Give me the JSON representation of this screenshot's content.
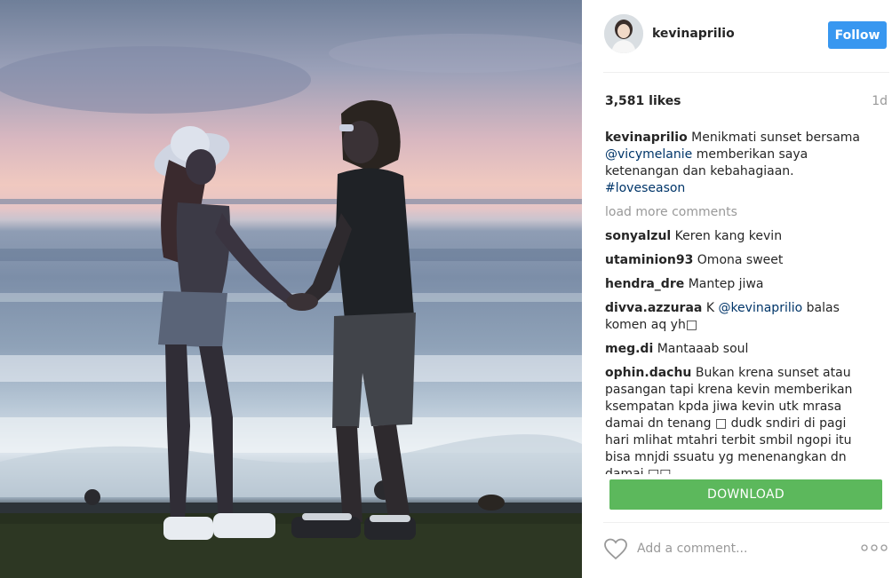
{
  "post": {
    "image_alt": "Couple holding hands at sunset by the sea",
    "author": {
      "username": "kevinaprilio",
      "avatar_icon": "profile-avatar"
    },
    "follow_label": "Follow",
    "likes": "3,581 likes",
    "age": "1d",
    "caption": {
      "user": "kevinaprilio",
      "text1": "Menikmati sunset bersama ",
      "mention": "@vicymelanie",
      "text2": " memberikan saya ketenangan dan kebahagiaan. ",
      "hashtag": "#loveseason"
    },
    "load_more": "load more comments",
    "comments": [
      {
        "user": "sonyalzul",
        "text": "Keren kang kevin"
      },
      {
        "user": "utaminion93",
        "text": "Omona sweet"
      },
      {
        "user": "hendra_dre",
        "text": "Mantep jiwa"
      },
      {
        "user": "divva.azzuraa",
        "text_before": "K ",
        "mention": "@kevinaprilio",
        "text_after": " balas komen aq yh□"
      },
      {
        "user": "meg.di",
        "text": "Mantaaab soul"
      },
      {
        "user": "ophin.dachu",
        "text": "Bukan krena sunset atau pasangan tapi krena kevin memberikan ksempatan kpda jiwa kevin utk mrasa damai dn tenang □ dudk sndiri di pagi hari mlihat mtahri terbit smbil ngopi itu bisa mnjdi ssuatu yg menenangkan dn damai □□"
      }
    ],
    "download_label": "DOWNLOAD",
    "add_comment_placeholder": "Add a comment...",
    "icons": {
      "like": "heart-icon",
      "options": "more-options-icon"
    },
    "colors": {
      "follow": "#3897f0",
      "download": "#5cb85c",
      "link": "#003569",
      "muted": "#999999"
    }
  }
}
